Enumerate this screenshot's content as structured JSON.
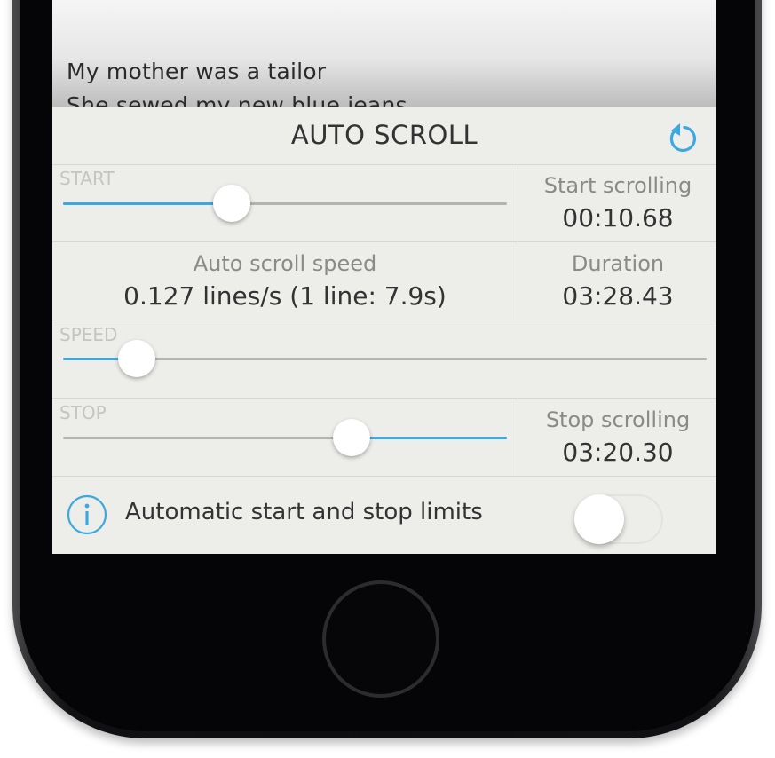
{
  "lyrics": {
    "line1": "My mother was a tailor",
    "line2": "She sewed my new blue jeans"
  },
  "panel": {
    "title": "AUTO SCROLL",
    "reset_icon": "rotate-ccw-icon",
    "start": {
      "label": "START",
      "position": 0.38,
      "stat_label": "Start scrolling",
      "stat_value": "00:10.68"
    },
    "speed_info": {
      "label": "Auto scroll speed",
      "value": "0.127 lines/s (1 line: 7.9s)",
      "duration_label": "Duration",
      "duration_value": "03:28.43"
    },
    "speed": {
      "label": "SPEED",
      "position": 0.115
    },
    "stop": {
      "label": "STOP",
      "position": 0.65,
      "stat_label": "Stop scrolling",
      "stat_value": "03:20.30"
    },
    "limits": {
      "info_icon": "info-icon",
      "label": "Automatic start and stop limits",
      "enabled": false
    }
  },
  "colors": {
    "accent": "#3ca8e0",
    "panel_bg": "#ededea",
    "track": "#b3b3b0"
  }
}
